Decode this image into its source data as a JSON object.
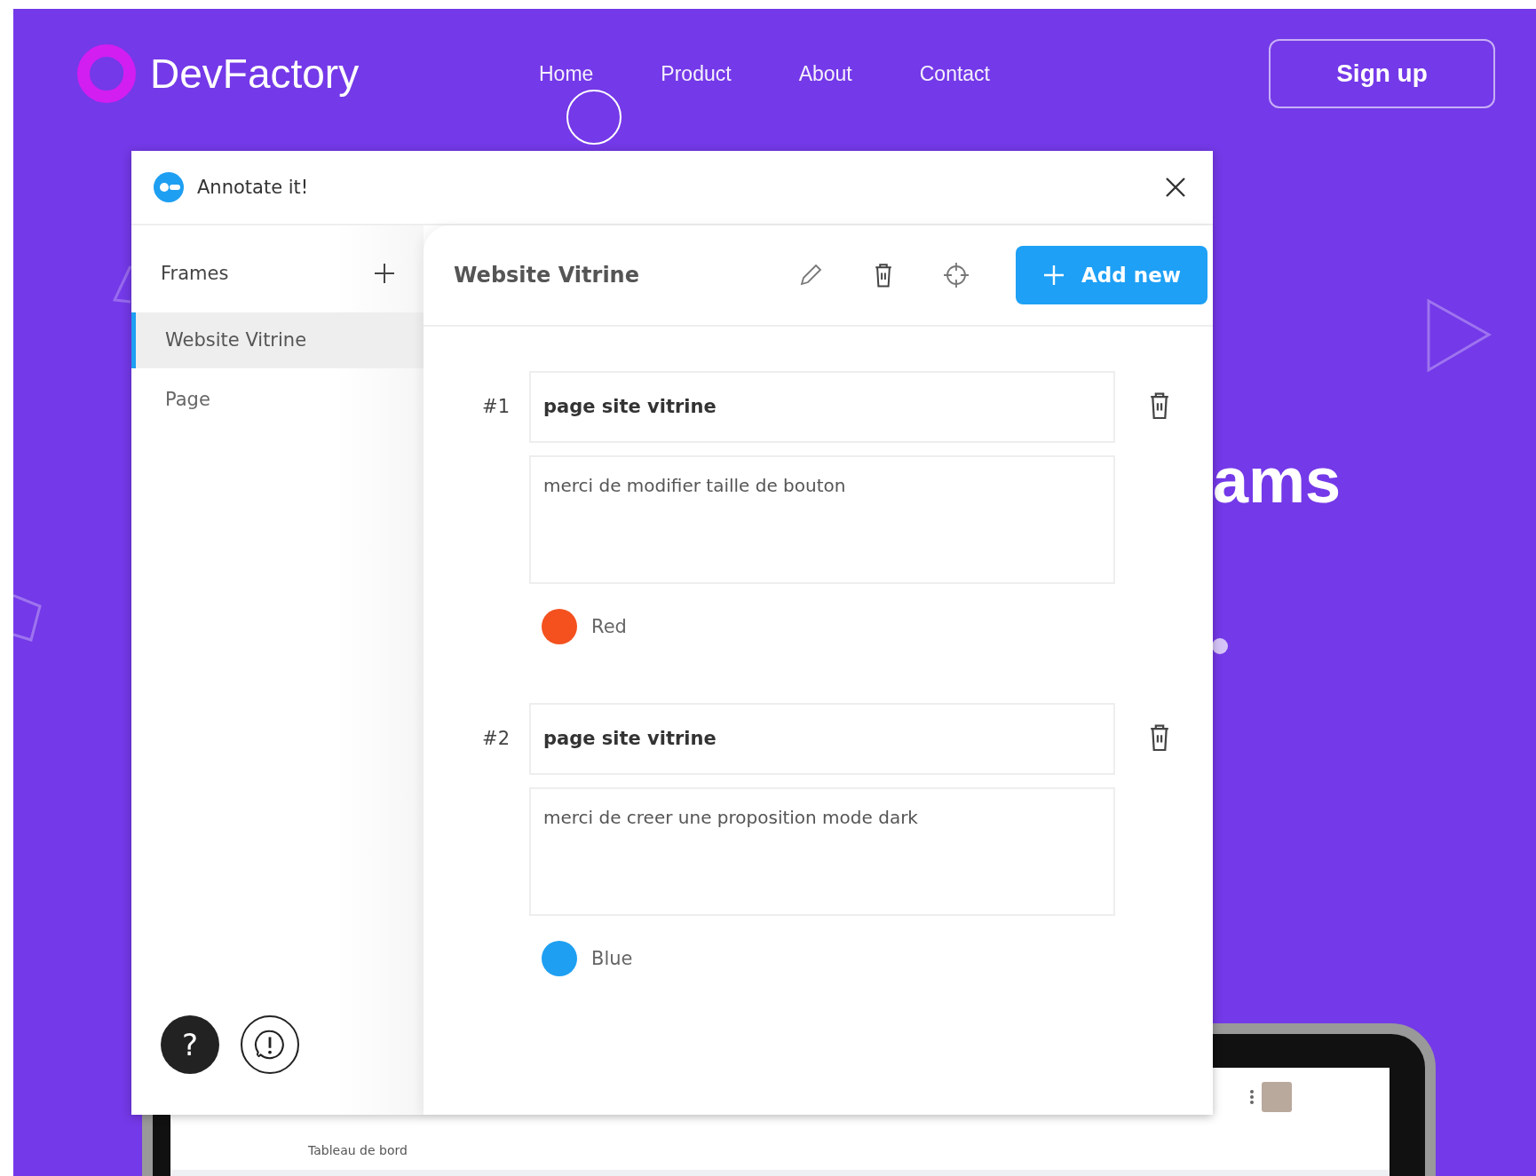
{
  "site": {
    "logo": "DevFactory",
    "nav": [
      {
        "label": "Home"
      },
      {
        "label": "Product"
      },
      {
        "label": "About"
      },
      {
        "label": "Contact"
      }
    ],
    "signup": "Sign up",
    "headline_fragment": "ams"
  },
  "laptop": {
    "breadcrumb": "Tableau de bord"
  },
  "panel": {
    "title": "Annotate it!",
    "frames_label": "Frames",
    "frames": [
      {
        "label": "Website Vitrine",
        "selected": true
      },
      {
        "label": "Page",
        "selected": false
      }
    ],
    "help_button": "?",
    "frame_title": "Website Vitrine",
    "add_button": "Add new",
    "annotations": [
      {
        "number": "#1",
        "title": "page site vitrine",
        "comment": "merci de modifier taille de bouton",
        "color": "#f4511e",
        "color_name": "Red"
      },
      {
        "number": "#2",
        "title": "page site vitrine",
        "comment": "merci de creer une proposition mode dark",
        "color": "#1e9ff2",
        "color_name": "Blue"
      }
    ]
  }
}
